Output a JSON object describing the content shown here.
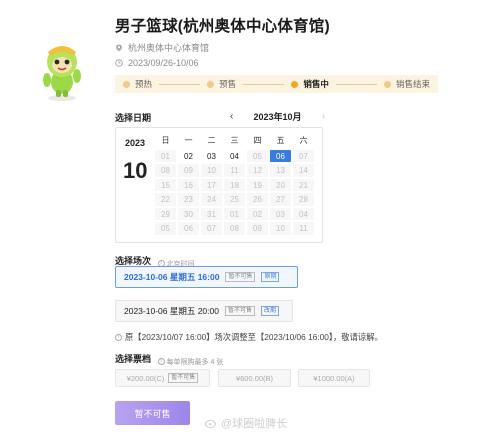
{
  "event": {
    "title": "男子篮球(杭州奥体中心体育馆)",
    "venue": "杭州奥体中心体育馆",
    "date_range": "2023/09/26-10/06"
  },
  "progress_steps": [
    {
      "label": "预热",
      "active": false
    },
    {
      "label": "预售",
      "active": false
    },
    {
      "label": "销售中",
      "active": true
    },
    {
      "label": "销售结束",
      "active": false
    }
  ],
  "date_section": {
    "label": "选择日期",
    "month": "2023年10月",
    "year": "2023",
    "day": "10",
    "weekdays": [
      "日",
      "一",
      "二",
      "三",
      "四",
      "五",
      "六"
    ],
    "cells": [
      [
        "01",
        "02",
        "03",
        "04",
        "05",
        "06",
        "07"
      ],
      [
        "08",
        "09",
        "10",
        "11",
        "12",
        "13",
        "14"
      ],
      [
        "15",
        "16",
        "17",
        "18",
        "19",
        "20",
        "21"
      ],
      [
        "22",
        "23",
        "24",
        "25",
        "26",
        "27",
        "28"
      ],
      [
        "29",
        "30",
        "31",
        "01",
        "02",
        "03",
        "04"
      ],
      [
        "05",
        "06",
        "07",
        "08",
        "09",
        "10",
        "11"
      ]
    ],
    "available": [
      "02",
      "03",
      "04"
    ],
    "selected": "06"
  },
  "session_section": {
    "label": "选择场次",
    "hint": "北京时间",
    "sessions": [
      {
        "text": "2023-10-06 星期五 16:00",
        "tags": [
          "暂不可售",
          "原期"
        ]
      },
      {
        "text": "2023-10-06 星期五 20:00",
        "tags": [
          "暂不可售",
          "改期"
        ]
      }
    ]
  },
  "notice": "原【2023/10/07 16:00】场次调整至【2023/10/06 16:00】，敬请谅解。",
  "ticket_section": {
    "label": "选择票档",
    "hint": "每单限购最多 4 张",
    "tickets": [
      {
        "price": "¥200.00(C)",
        "tag": "暂不可售"
      },
      {
        "price": "¥600.00(B)",
        "tag": ""
      },
      {
        "price": "¥1000.00(A)",
        "tag": ""
      }
    ]
  },
  "buy_button": "暂不可售",
  "watermark": "@球圈啦脾长"
}
